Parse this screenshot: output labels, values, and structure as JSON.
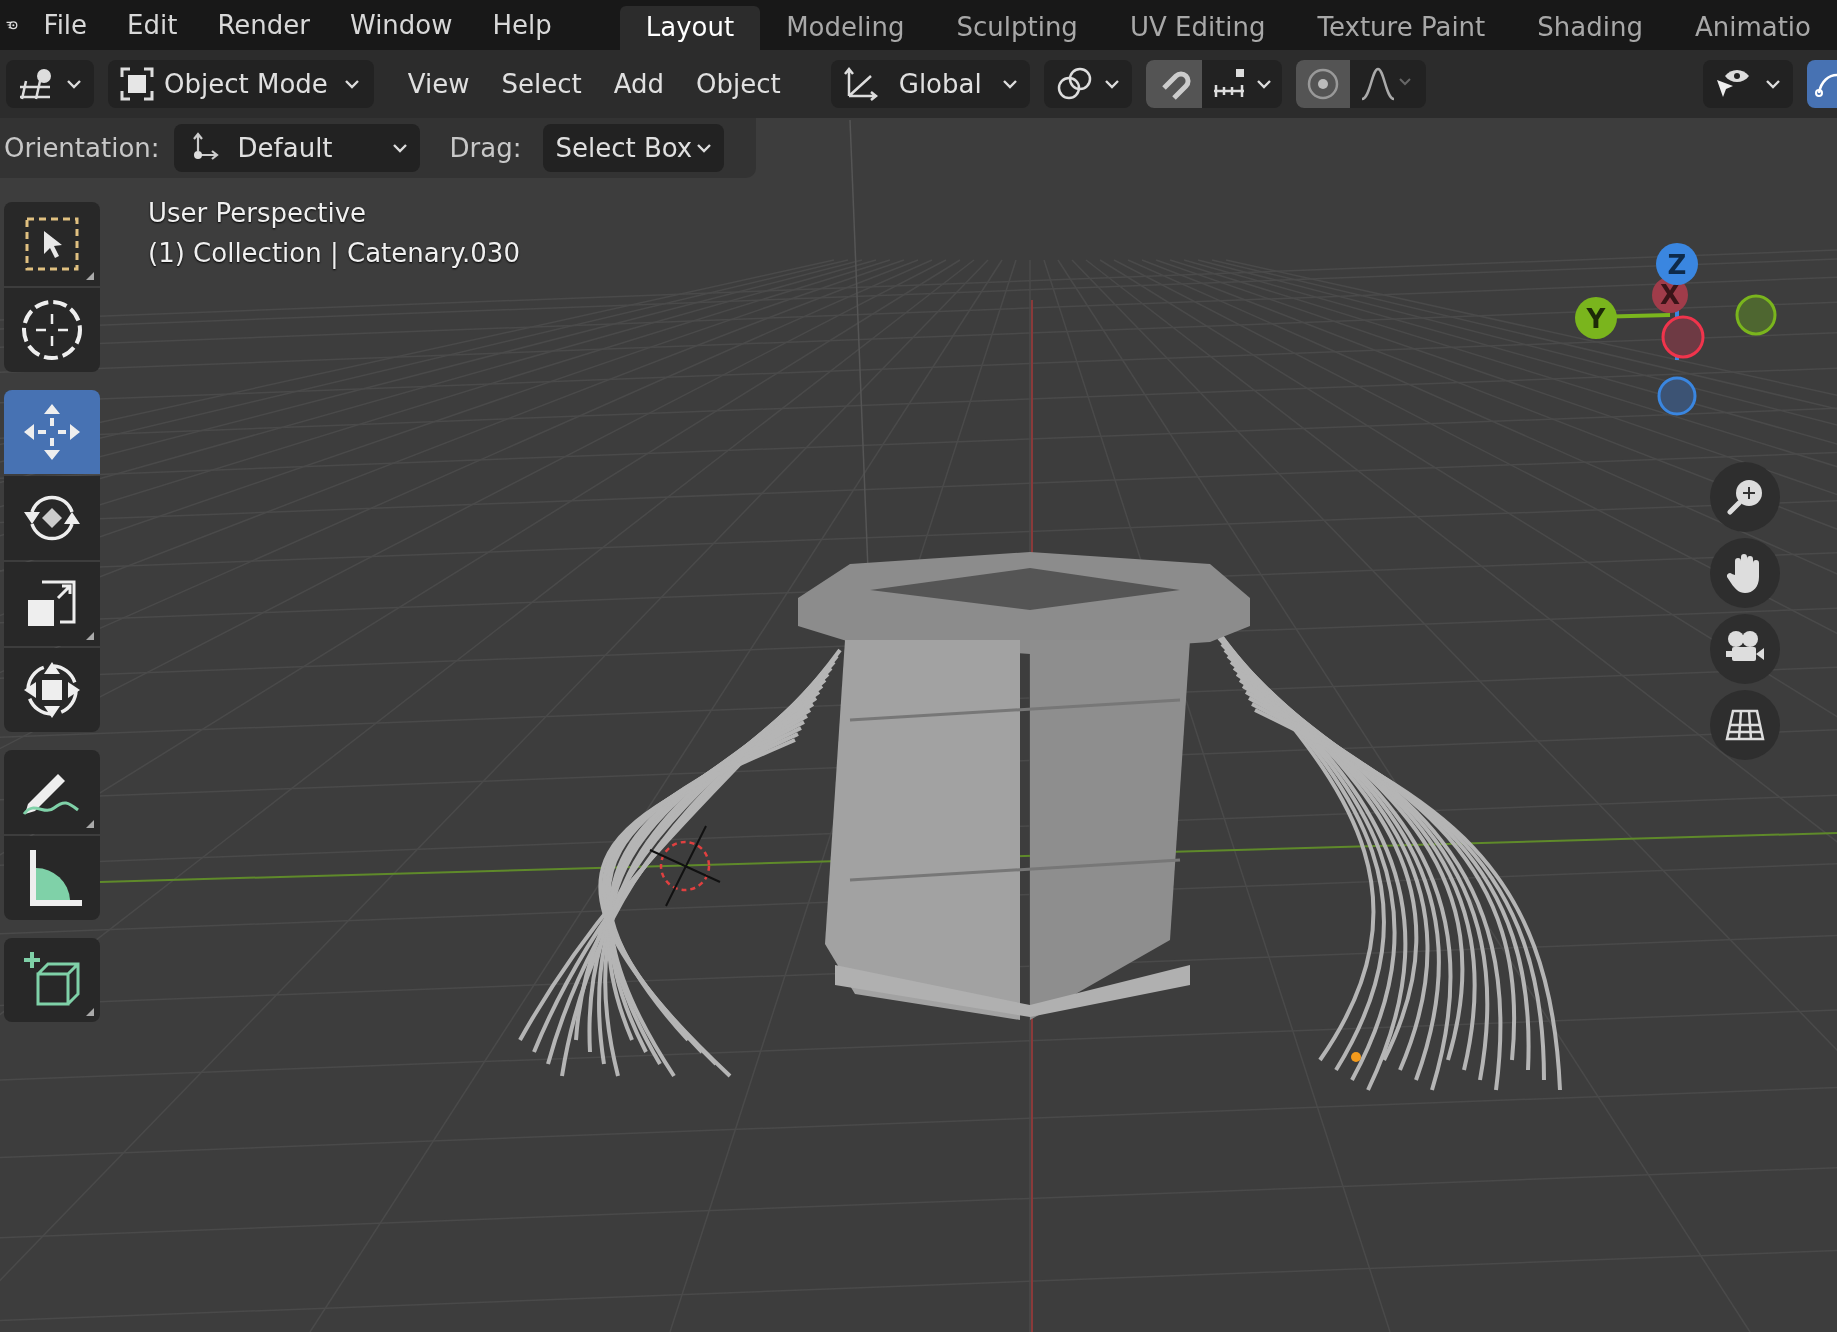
{
  "top_menu": [
    "File",
    "Edit",
    "Render",
    "Window",
    "Help"
  ],
  "workspace_tabs": [
    {
      "label": "Layout",
      "selected": true
    },
    {
      "label": "Modeling",
      "selected": false
    },
    {
      "label": "Sculpting",
      "selected": false
    },
    {
      "label": "UV Editing",
      "selected": false
    },
    {
      "label": "Texture Paint",
      "selected": false
    },
    {
      "label": "Shading",
      "selected": false
    },
    {
      "label": "Animatio",
      "selected": false
    }
  ],
  "header": {
    "mode": "Object Mode",
    "menus": [
      "View",
      "Select",
      "Add",
      "Object"
    ],
    "transform_orientation": "Global"
  },
  "tool_settings": {
    "orientation_label": "Orientation:",
    "orientation": "Default",
    "drag_label": "Drag:",
    "drag": "Select Box"
  },
  "viewport": {
    "view_name": "User Perspective",
    "object_info": "(1) Collection | Catenary.030"
  },
  "toolbar": [
    {
      "tools": [
        {
          "kind": "select",
          "selected": false
        },
        {
          "kind": "cursor",
          "selected": false
        }
      ]
    },
    {
      "tools": [
        {
          "kind": "move",
          "selected": true
        },
        {
          "kind": "rotate",
          "selected": false
        },
        {
          "kind": "scale",
          "selected": false
        },
        {
          "kind": "transform",
          "selected": false
        }
      ]
    },
    {
      "tools": [
        {
          "kind": "annotate",
          "selected": false
        },
        {
          "kind": "measure",
          "selected": false
        }
      ]
    },
    {
      "tools": [
        {
          "kind": "add-cube",
          "selected": false
        }
      ]
    }
  ],
  "axis_gizmo": {
    "z": "Z",
    "x": "X",
    "y": "Y"
  }
}
